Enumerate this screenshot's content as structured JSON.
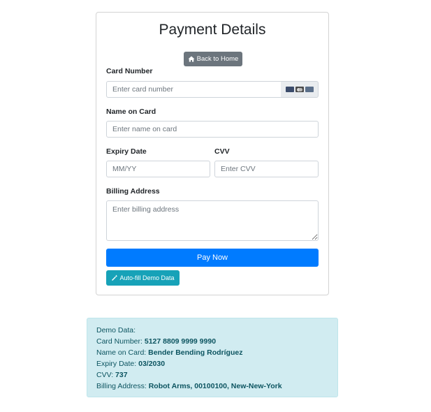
{
  "form": {
    "title": "Payment Details",
    "back_button": "Back to Home",
    "card_number": {
      "label": "Card Number",
      "placeholder": "Enter card number",
      "value": ""
    },
    "card_icons": [
      "visa-icon",
      "mastercard-icon",
      "amex-icon"
    ],
    "name_on_card": {
      "label": "Name on Card",
      "placeholder": "Enter name on card",
      "value": ""
    },
    "expiry": {
      "label": "Expiry Date",
      "placeholder": "MM/YY",
      "value": ""
    },
    "cvv": {
      "label": "CVV",
      "placeholder": "Enter CVV",
      "value": ""
    },
    "billing_address": {
      "label": "Billing Address",
      "placeholder": "Enter billing address",
      "value": ""
    },
    "pay_button": "Pay Now",
    "autofill_button": "Auto-fill Demo Data"
  },
  "demo": {
    "heading": "Demo Data:",
    "rows": [
      {
        "label": "Card Number: ",
        "value": "5127 8809 9999 9990"
      },
      {
        "label": "Name on Card: ",
        "value": "Bender Bending Rodríguez"
      },
      {
        "label": "Expiry Date: ",
        "value": "03/2030"
      },
      {
        "label": "CVV: ",
        "value": "737"
      },
      {
        "label": "Billing Address: ",
        "value": "Robot Arms, 00100100, New-New-York"
      }
    ]
  },
  "colors": {
    "primary": "#007bff",
    "secondary": "#6c757d",
    "info": "#17a2b8",
    "alert_bg": "#d1ecf1",
    "alert_text": "#0c5460"
  }
}
